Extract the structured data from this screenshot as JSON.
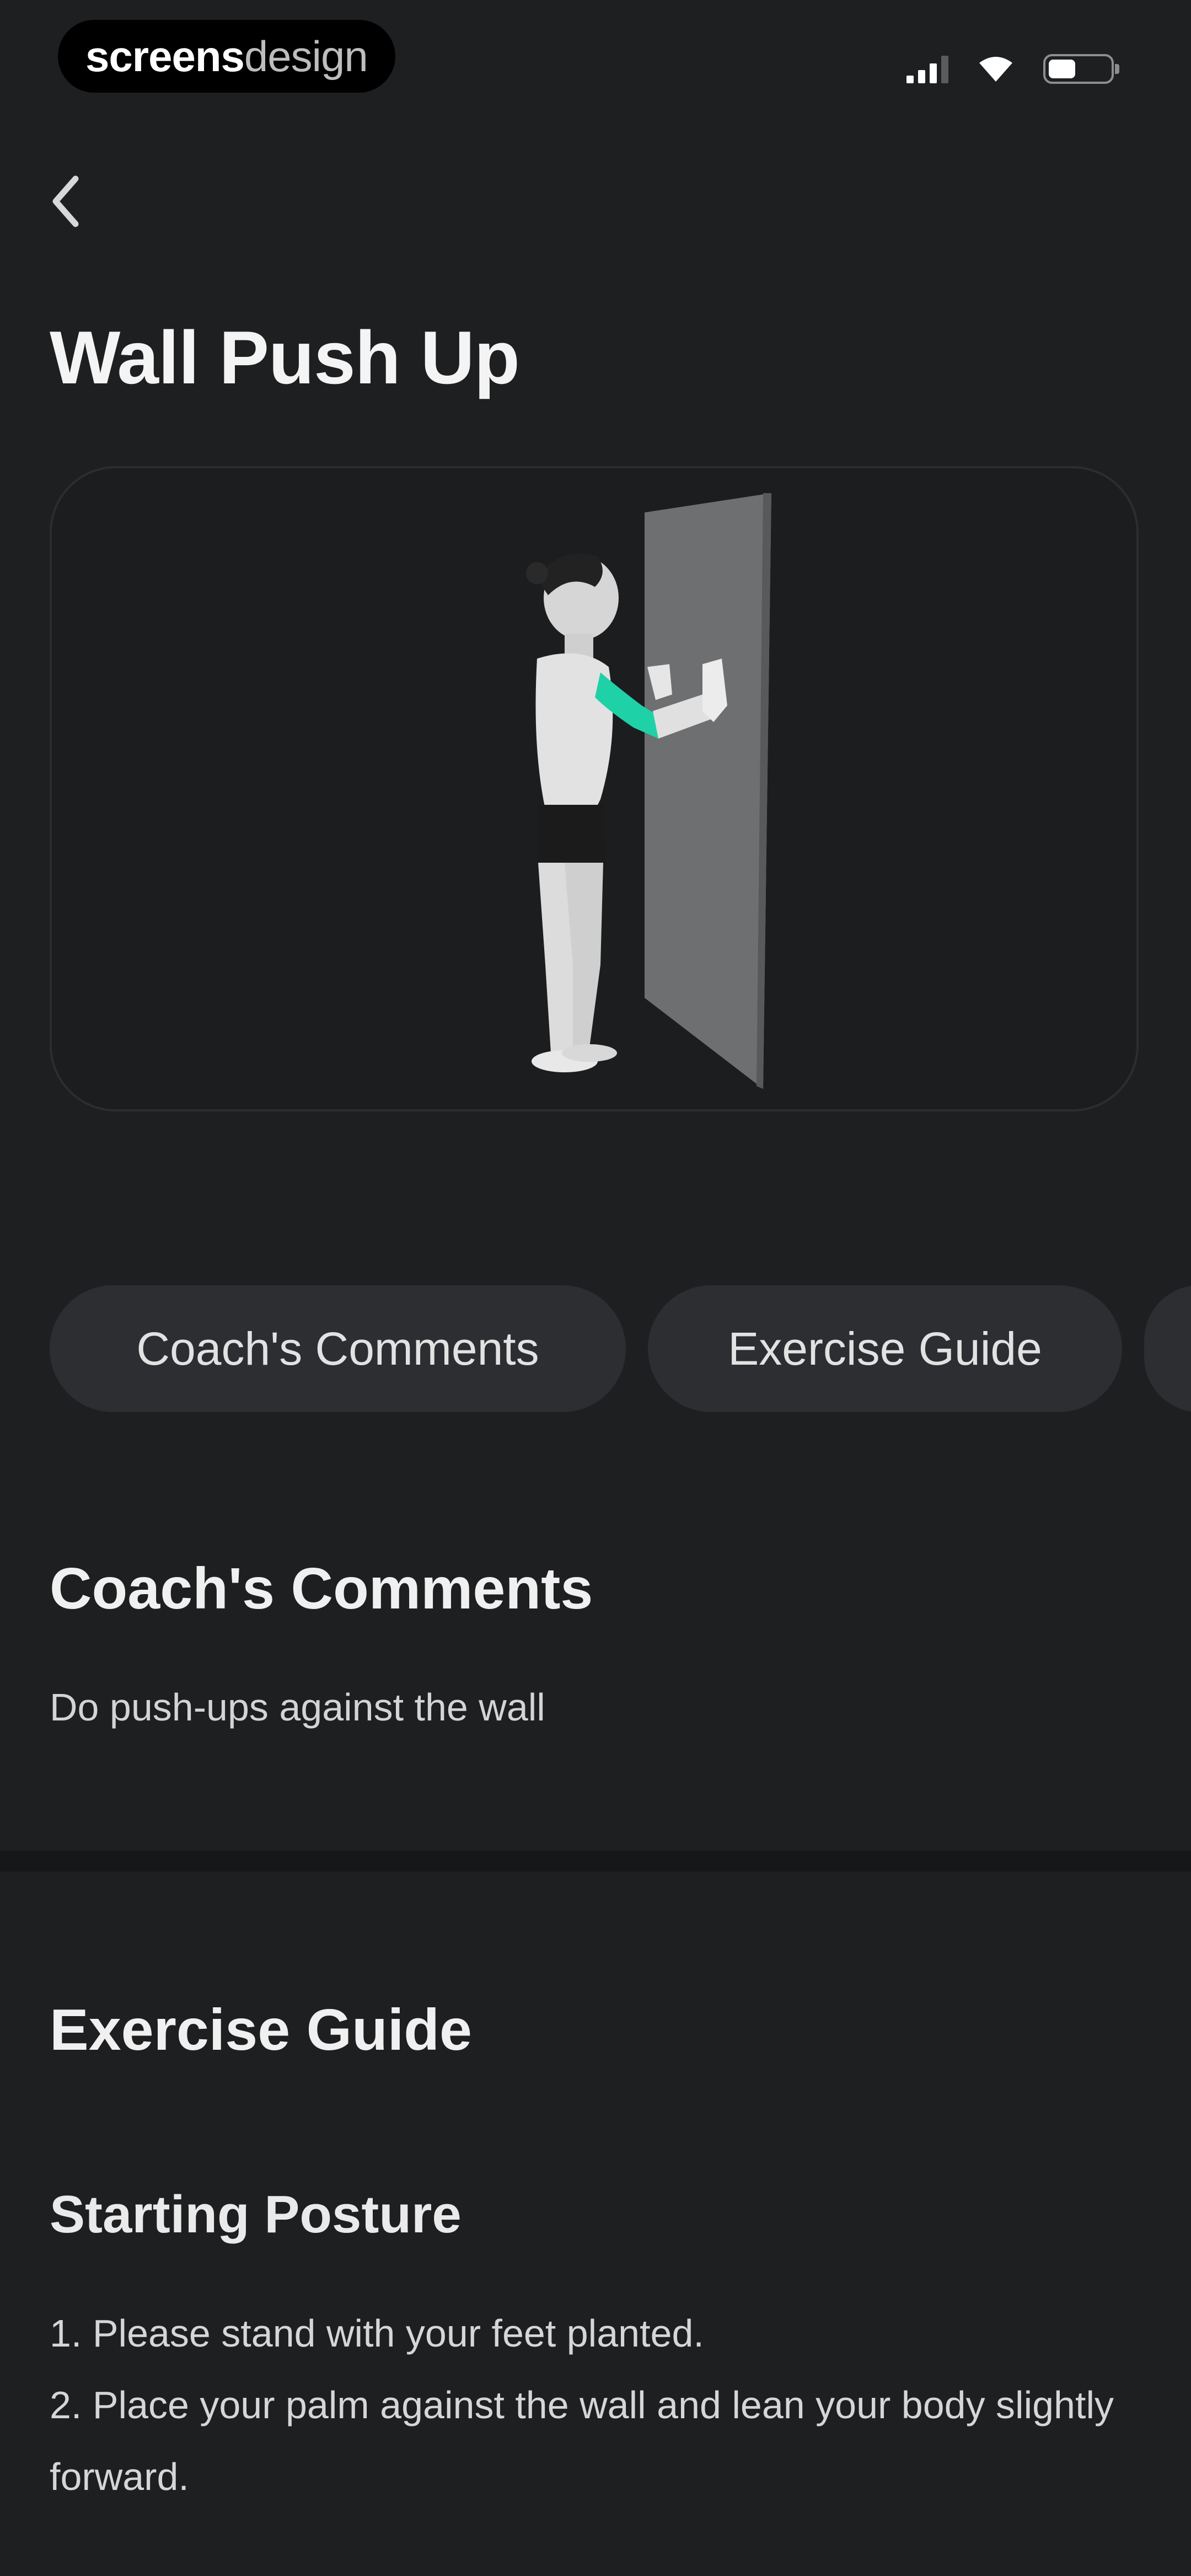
{
  "status_bar": {
    "brand_strong": "screens",
    "brand_light": "design",
    "icons": [
      "signal-icon",
      "wifi-icon",
      "battery-icon"
    ]
  },
  "nav": {
    "back_icon": "chevron-left-icon"
  },
  "title": "Wall Push Up",
  "illustration": {
    "icon": "wall-push-up-figure",
    "highlight_color": "#1fd1a6"
  },
  "tabs": [
    {
      "label": "Coach's Comments"
    },
    {
      "label": "Exercise Guide"
    },
    {
      "label": ""
    }
  ],
  "coach_comments": {
    "title": "Coach's Comments",
    "text": "Do push-ups against the wall"
  },
  "exercise_guide": {
    "title": "Exercise Guide",
    "starting_posture": {
      "title": "Starting Posture",
      "steps": [
        "1. Please stand with your feet planted.",
        "2. Place your palm against the wall and lean your body slightly forward."
      ]
    }
  },
  "colors": {
    "background": "#1e1f21",
    "card_border": "#2c2d30",
    "tab_background": "#2d2e32",
    "accent": "#1fd1a6"
  }
}
